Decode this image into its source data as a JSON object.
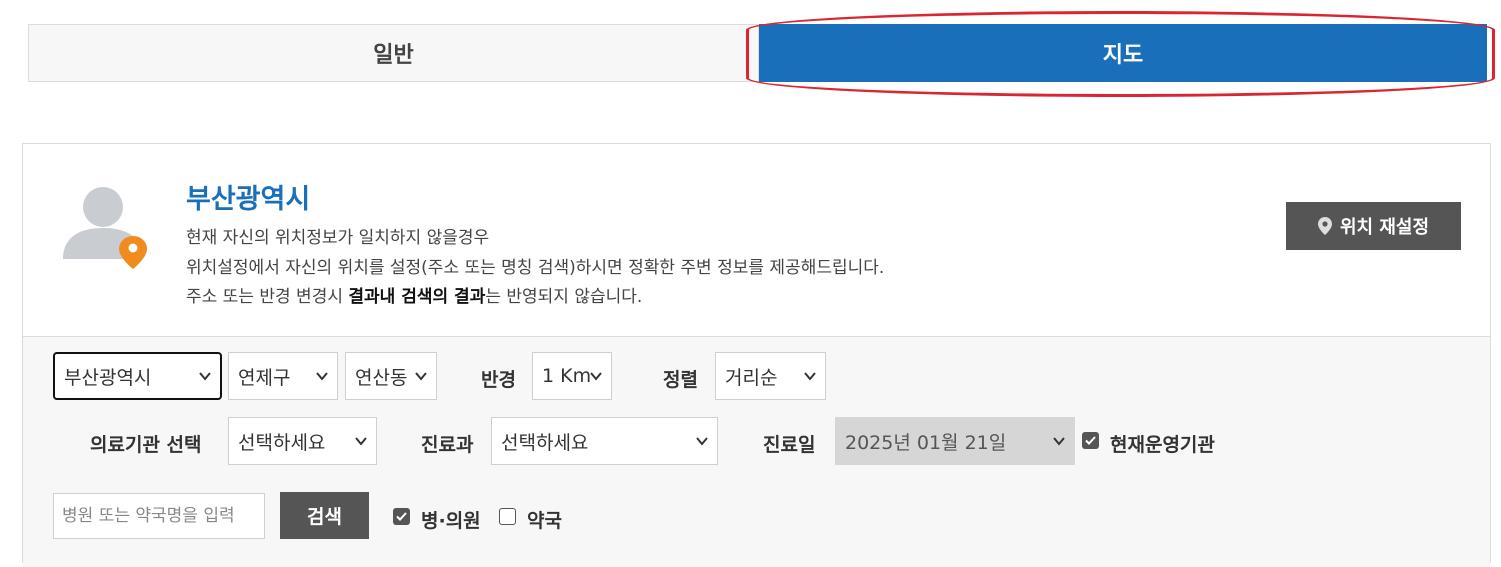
{
  "tabs": [
    {
      "label": "일반",
      "active": false
    },
    {
      "label": "지도",
      "active": true
    }
  ],
  "colors": {
    "accent": "#1a6fba",
    "highlight": "#d9262f",
    "dark_button": "#555555",
    "pin": "#f08c1e"
  },
  "location": {
    "city": "부산광역시",
    "line1": "현재 자신의 위치정보가 일치하지 않을경우",
    "line2": "위치설정에서 자신의 위치를 설정(주소 또는 명칭 검색)하시면 정확한 주변 정보를 제공해드립니다.",
    "line3_pre": "주소 또는 반경 변경시 ",
    "line3_bold": "결과내 검색의 결과",
    "line3_post": "는 반영되지 않습니다.",
    "reset_label": "위치 재설정",
    "reset_icon": "map-pin-icon"
  },
  "filters": {
    "city_value": "부산광역시",
    "district_value": "연제구",
    "dong_value": "연산동",
    "radius_label": "반경",
    "radius_value": "1 Km",
    "sort_label": "정렬",
    "sort_value": "거리순",
    "institution_label": "의료기관 선택",
    "institution_value": "선택하세요",
    "dept_label": "진료과",
    "dept_value": "선택하세요",
    "date_label": "진료일",
    "date_value": "2025년 01월 21일",
    "operating_label": "현재운영기관",
    "operating_checked": true
  },
  "search": {
    "placeholder": "병원 또는 약국명을 입력",
    "button_label": "검색",
    "hospital_label": "병·의원",
    "hospital_checked": true,
    "pharmacy_label": "약국",
    "pharmacy_checked": false
  }
}
